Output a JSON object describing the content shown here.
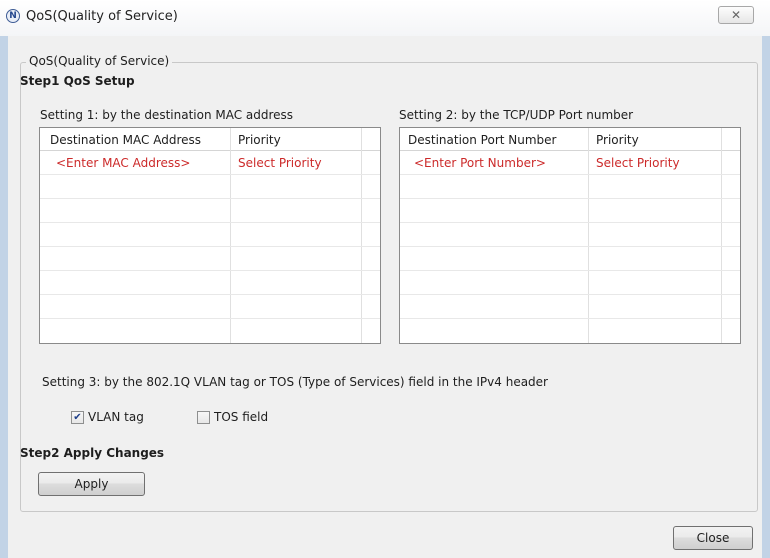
{
  "window": {
    "title": "QoS(Quality of Service)",
    "icon_letter": "N",
    "close_glyph": "✕"
  },
  "group": {
    "legend": "QoS(Quality of Service)"
  },
  "step1": {
    "label": "Step1  QoS Setup"
  },
  "setting1": {
    "label": "Setting 1: by the destination MAC address",
    "columns": [
      "Destination MAC Address",
      "Priority"
    ],
    "row": {
      "address": "<Enter MAC Address>",
      "priority": "Select Priority"
    }
  },
  "setting2": {
    "label": "Setting 2: by the TCP/UDP Port number",
    "columns": [
      "Destination Port Number",
      "Priority"
    ],
    "row": {
      "port": "<Enter Port Number>",
      "priority": "Select Priority"
    }
  },
  "setting3": {
    "label": "Setting 3: by the 802.1Q VLAN tag or TOS (Type of Services) field in the IPv4 header",
    "vlan": {
      "label": "VLAN tag",
      "checked": true
    },
    "tos": {
      "label": "TOS field",
      "checked": false
    }
  },
  "step2": {
    "label": "Step2  Apply Changes"
  },
  "buttons": {
    "apply": "Apply",
    "close": "Close"
  },
  "colors": {
    "placeholder_text": "#cc2a2a",
    "window_frame": "#c2d3e6",
    "dialog_bg": "#f0f0f0"
  }
}
